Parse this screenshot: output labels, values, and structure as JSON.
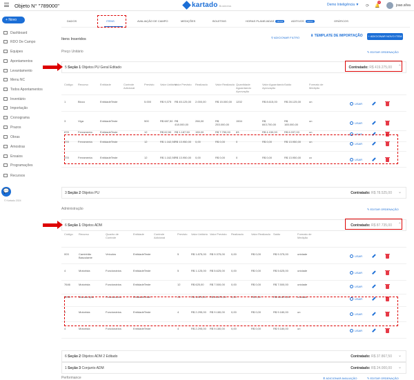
{
  "header": {
    "title": "Objeto N° \"789000\"",
    "logo": "kartado",
    "logo_sub": "Business",
    "workspace": "Demo Inteligência ▼",
    "notification_count": "1",
    "user": "joao.silva"
  },
  "sidebar": {
    "new_label": "Novo",
    "items": [
      "Dashboard",
      "RDO De Campo",
      "Equipes",
      "Apontamentos",
      "Levantamento",
      "Menu NC",
      "Todos Apontamentos",
      "Inventário",
      "Importação",
      "Cronograma",
      "Prazos",
      "Obras",
      "Amostras",
      "Ensaios",
      "Programações",
      "Recursos"
    ],
    "version": "© Kartado 2024"
  },
  "tabs": [
    "Dados",
    "Itens",
    "Avaliação de Campo",
    "Medições",
    "Boletins",
    "Horas Planejadas",
    "Aditivos",
    "Gráficos"
  ],
  "tab_badges": {
    "horas": "NOVO",
    "aditivos": "NOVO"
  },
  "toolbar": {
    "section_title": "Itens Inseridos",
    "filter_label": "ADICIONAR FILTRO",
    "template_label": "TEMPLATE DE IMPORTAÇÃO",
    "add_item_label": "ADICIONAR NOVO ITEM",
    "edit_order_label": "EDITAR ORDENAÇÃO"
  },
  "groups": {
    "preco_unitario": "Preço Unitário",
    "administracao": "Administração",
    "performance": "Performance",
    "add_avaliacao": "ADICIONAR AVALIAÇÃO"
  },
  "sections": {
    "s1": {
      "num": "5",
      "label": "Seção 1",
      "name": "Objetos PU Geral Editado",
      "contr_label": "Contratado:",
      "contr_val": "R$ 419.275,00"
    },
    "s2": {
      "num": "3",
      "label": "Seção 2",
      "name": "Objetos PU",
      "contr_label": "Contratado:",
      "contr_val": "R$ 78.525,00"
    },
    "s3": {
      "num": "6",
      "label": "Seção 1",
      "name": "Objetos ADM",
      "contr_label": "Contratado:",
      "contr_val": "R$ 87.735,00"
    },
    "s4": {
      "num": "6",
      "label": "Seção 2",
      "name": "Objetos ADM 2 Editado",
      "contr_label": "Contratado:",
      "contr_val": "R$ 37.867,50"
    },
    "s5": {
      "num": "1",
      "label": "Seção 3",
      "name": "Conjunto ADM",
      "contr_label": "Contratado:",
      "contr_val": "R$ 24.000,00"
    }
  },
  "usar_label": "USAR",
  "pu_table": {
    "headers": [
      "Código",
      "Recurso",
      "Entidade",
      "Controle Adicional",
      "Previsto",
      "Valor Unitário",
      "Valor Previsto",
      "Realizado",
      "Valor Realizado",
      "Quantidade Aguardando Aprovação",
      "Valor Aguardando Aprovação",
      "Saldo",
      "Formato de Medição"
    ],
    "rows": [
      [
        "1",
        "Bloco",
        "EntidadeTeste",
        "",
        "5.000",
        "R$ 9,375",
        "R$ 45.125,00",
        "2.000,00",
        "R$ 15.000,00",
        "1202",
        "R$ 8.615,00",
        "R$ 28.125,00",
        "un"
      ],
      [
        "3",
        "Viga",
        "EntidadeTeste",
        "",
        "500",
        "R$ 687,50",
        "R$ 418.000,00",
        "266,00",
        "R$ 253.000,00",
        "1504",
        "R$ 843.700,00",
        "R$ 165.000,00",
        "un"
      ],
      [
        "878",
        "Ferramenta",
        "EntidadeTeste",
        "",
        "12",
        "R$ 62,50",
        "R$ 1.187,50",
        "155,00",
        "R$ 7.750,00",
        "83",
        "R$ 4.150,00",
        "R$ 6.937,00",
        "un"
      ],
      [
        "878",
        "Ferramenta",
        "EntidadeTeste",
        "",
        "12",
        "R$ 1.162,50",
        "R$ 13.950,00",
        "0,00",
        "R$ 0,00",
        "0",
        "R$ 0,00",
        "R$ 13.950,00",
        "un"
      ],
      [
        "878",
        "Ferramenta",
        "EntidadeTeste",
        "",
        "12",
        "R$ 1.162,50",
        "R$ 13.950,00",
        "0,00",
        "R$ 0,00",
        "0",
        "R$ 0,00",
        "R$ 13.950,00",
        "cx"
      ]
    ]
  },
  "adm_table": {
    "headers": [
      "Código",
      "Recurso",
      "Quadro de Controle",
      "Entidade",
      "Controle Adicional",
      "Previsto",
      "Valor Unitário",
      "Valor Previsto",
      "Realizado",
      "Valor Realizado",
      "Saldo",
      "Formato de Medição"
    ],
    "rows": [
      [
        "003",
        "Caminhão Basculante",
        "Veículos",
        "EntidadeTeste",
        "",
        "5",
        "R$ 1.875,00",
        "R$ 9.375,00",
        "0,00",
        "R$ 0,00",
        "R$ 9.375,00",
        "unidade"
      ],
      [
        "4",
        "Motorista",
        "Funcionários",
        "EntidadeTeste",
        "",
        "5",
        "R$ 1.125,00",
        "R$ 5.625,00",
        "0,00",
        "R$ 0,00",
        "R$ 5.625,00",
        "unidade"
      ],
      [
        "7646",
        "Motorista",
        "Funcionários",
        "EntidadeTeste",
        "",
        "12",
        "R$ 625,00",
        "R$ 7.500,00",
        "0,00",
        "R$ 0,00",
        "R$ 7.500,00",
        "unidade"
      ],
      [
        "3998",
        "Manutenção",
        "Funcionários",
        "EntidadeTeste",
        "",
        "25",
        "R$ 1.875,00",
        "R$ 46.875,00",
        "0,00",
        "R$ 0,00",
        "R$ 46.875,00",
        "unidade"
      ],
      [
        "4",
        "Motorista",
        "Funcionários",
        "EntidadeTeste",
        "",
        "4",
        "R$ 2.295,00",
        "R$ 9.180,00",
        "0,00",
        "R$ 0,00",
        "R$ 9.180,00",
        "un"
      ],
      [
        "4",
        "Motorista",
        "Funcionários",
        "EntidadeTeste",
        "",
        "4",
        "R$ 2.295,00",
        "R$ 9.180,00",
        "0,00",
        "R$ 0,00",
        "R$ 9.180,00",
        "un"
      ]
    ]
  },
  "colors": {
    "accent": "#1b6ed6",
    "annotation": "#dd0000",
    "delete": "#e63946"
  }
}
